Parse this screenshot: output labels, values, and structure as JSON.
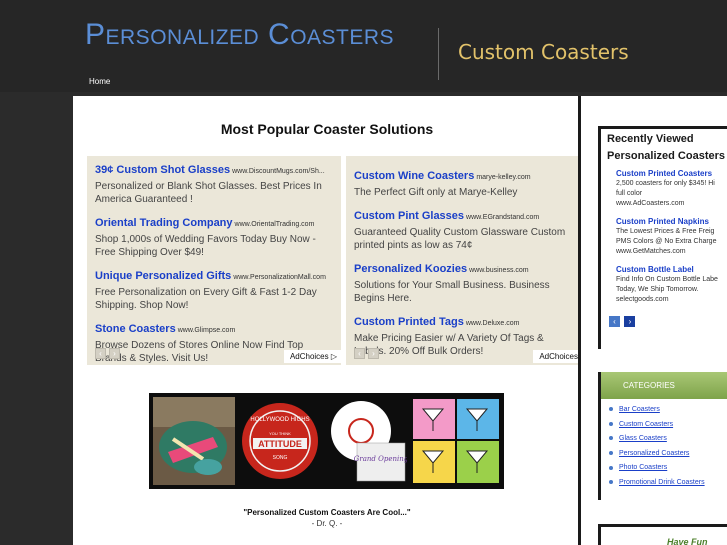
{
  "header": {
    "title": "Personalized Coasters",
    "tagline": "Custom Coasters",
    "nav": {
      "home": "Home"
    }
  },
  "main": {
    "heading": "Most Popular Coaster Solutions",
    "ads_left": [
      {
        "title": "39¢ Custom Shot Glasses",
        "url": "www.DiscountMugs.com/Sh...",
        "desc": "Personalized or Blank Shot Glasses. Best Prices In America Guaranteed !"
      },
      {
        "title": "Oriental Trading Company",
        "url": "www.OrientalTrading.com",
        "desc": "Shop 1,000s of Wedding Favors Today Buy Now - Free Shipping Over $49!"
      },
      {
        "title": "Unique Personalized Gifts",
        "url": "www.PersonalizationMall.com",
        "desc": "Free Personalization on Every Gift & Fast 1-2 Day Shipping. Shop Now!"
      },
      {
        "title": "Stone Coasters",
        "url": "www.Glimpse.com",
        "desc": "Browse Dozens of Stores Online Now Find Top Brands & Styles. Visit Us!"
      }
    ],
    "ads_right": [
      {
        "title": "Custom Wine Coasters",
        "url": "marye-kelley.com",
        "desc": "The Perfect Gift only at Marye-Kelley"
      },
      {
        "title": "Custom Pint Glasses",
        "url": "www.EGrandstand.com",
        "desc": "Guaranteed Quality Custom Glassware Custom printed pints as low as 74¢"
      },
      {
        "title": "Personalized Koozies",
        "url": "www.business.com",
        "desc": "Solutions for Your Small Business. Business Begins Here."
      },
      {
        "title": "Custom Printed Tags",
        "url": "www.Deluxe.com",
        "desc": "Make Pricing Easier w/ A Variety Of Tags & Labels. 20% Off Bulk Orders!"
      }
    ],
    "adchoices_left": "AdChoices ▷",
    "adchoices_right": "AdChoices",
    "coaster_text": {
      "hollywood_top": "HOLLYWOOD HIGHS",
      "attitude_line1": "YOU THINK",
      "attitude_main": "ATTITUDE",
      "attitude_line2": "SONG",
      "grand_opening": "Grand Opening"
    },
    "quote": "\"Personalized Custom Coasters Are Cool...\"",
    "quote_author": "- Dr. Q. -"
  },
  "sidebar": {
    "recent_heading_line1": "Recently Viewed",
    "recent_heading_line2": "Personalized Coasters",
    "recent_ads": [
      {
        "title": "Custom Printed Coasters",
        "desc1": "2,500 coasters for only $345! Hi",
        "desc2": "full color",
        "url": "www.AdCoasters.com"
      },
      {
        "title": "Custom Printed Napkins",
        "desc1": "The Lowest Prices & Free Freig",
        "desc2": "PMS Colors @ No Extra Charge",
        "url": "www.GetMatches.com"
      },
      {
        "title": "Custom Bottle Label",
        "desc1": "Find Info On Custom Bottle Labe",
        "desc2": "Today, We Ship Tomorrow.",
        "url": "selectgoods.com"
      }
    ],
    "categories_heading": "CATEGORIES",
    "categories": [
      "Bar Coasters",
      "Custom Coasters",
      "Glass Coasters",
      "Personalized Coasters",
      "Photo Coasters",
      "Promotional Drink Coasters"
    ],
    "have_fun": "Have Fun"
  },
  "colors": {
    "header_bg": "#262626",
    "title_blue": "#5b8ed6",
    "tagline_gold": "#e2c26a",
    "ad_bg": "#ebe7d9",
    "link_blue": "#1a3fc8",
    "category_green": "#7ea34a"
  }
}
